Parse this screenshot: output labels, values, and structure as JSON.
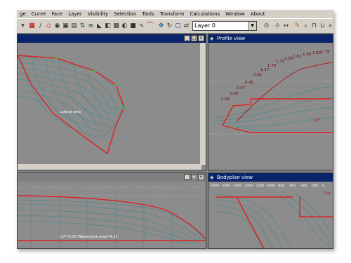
{
  "menu": [
    "ge",
    "Curve",
    "Face",
    "Layer",
    "Visibility",
    "Selection",
    "Tools",
    "Transform",
    "Calculations",
    "Window",
    "About"
  ],
  "toolbar": {
    "layer_value": "Layer 0",
    "icons": [
      "select-icon",
      "grid-icon",
      "curve-icon",
      "face-icon",
      "globe-icon",
      "camera-icon",
      "render-icon",
      "flip-icon",
      "stack-icon",
      "wedge-icon",
      "arc-icon",
      "pen-icon",
      "move-icon",
      "rotate-icon",
      "mirror-icon",
      "zoom-icon",
      "color-icon",
      "lock-icon",
      "unlock-icon",
      "snap-icon",
      "pan-icon"
    ]
  },
  "views": {
    "perspective": {
      "title": ""
    },
    "profile": {
      "title": "Profile view",
      "area_labels": [
        "1.56",
        "1.82",
        "1.86",
        "1.83",
        "1.79",
        "1.75",
        "1.70",
        "1.27",
        "0.91",
        "0.45",
        "0.07",
        "0.06",
        "0.08"
      ],
      "cog_label": "LCF"
    },
    "plan": {
      "title": "",
      "annotation": "LCF=5.00 Waterplane area=9.22"
    },
    "bodyplan": {
      "title": "Bodyplan view",
      "ruler": [
        "-2000",
        "-1800",
        "-1600",
        "-1400",
        "-1200",
        "-1000",
        "-800",
        "-600",
        "-400",
        "-200",
        "0"
      ],
      "side_label": "Cur"
    }
  }
}
